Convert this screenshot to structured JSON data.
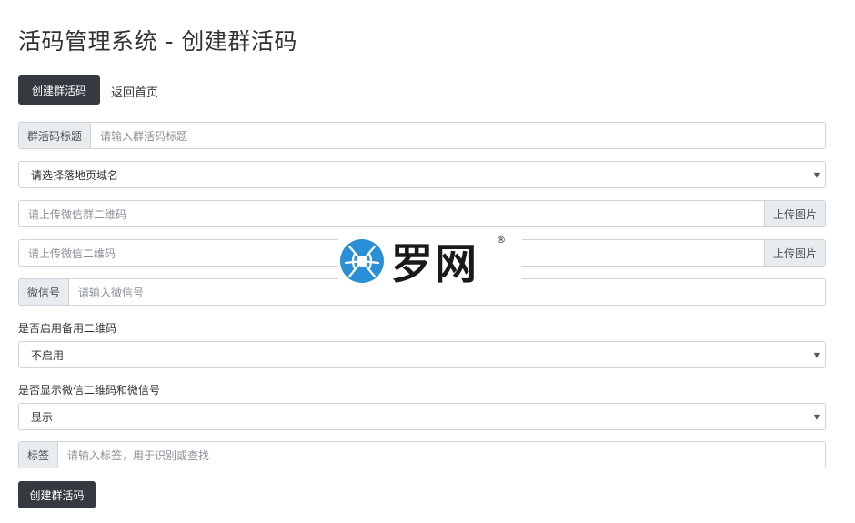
{
  "page": {
    "title": "活码管理系统 - 创建群活码"
  },
  "nav": {
    "create_button": "创建群活码",
    "back_link": "返回首页"
  },
  "form": {
    "title_field": {
      "addon": "群活码标题",
      "placeholder": "请输入群活码标题"
    },
    "domain_select": {
      "selected": "请选择落地页域名"
    },
    "group_qr_upload": {
      "placeholder": "请上传微信群二维码",
      "button": "上传图片"
    },
    "wechat_qr_upload": {
      "placeholder": "请上传微信二维码",
      "button": "上传图片"
    },
    "wechat_id": {
      "addon": "微信号",
      "placeholder": "请输入微信号"
    },
    "backup_qr": {
      "label": "是否启用备用二维码",
      "selected": "不启用"
    },
    "show_wechat": {
      "label": "是否显示微信二维码和微信号",
      "selected": "显示"
    },
    "tag": {
      "addon": "标签",
      "placeholder": "请输入标签，用于识别或查找"
    },
    "submit_button": "创建群活码"
  },
  "watermark": {
    "text": "罗网",
    "mark": "®",
    "icon": "spider-logo-icon",
    "color": "#2a8fd6"
  }
}
